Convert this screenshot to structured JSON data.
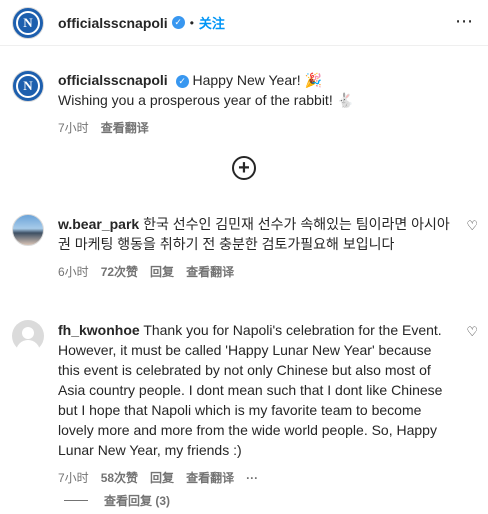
{
  "header": {
    "username": "officialsscnapoli",
    "separator": "•",
    "follow_label": "关注",
    "more_glyph": "⋯"
  },
  "caption": {
    "username": "officialsscnapoli",
    "line1": "Happy New Year! 🎉",
    "line2": "Wishing you a prosperous year of the rabbit! 🐇",
    "time": "7小时",
    "translate": "查看翻译"
  },
  "comments": [
    {
      "username": "w.bear_park",
      "text": "한국 선수인 김민재 선수가 속해있는 팀이라면 아시아권 마케팅 행동을 취하기 전 충분한 검토가필요해 보입니다",
      "time": "6小时",
      "likes": "72次赞",
      "reply": "回复",
      "translate": "查看翻译"
    },
    {
      "username": "fh_kwonhoe",
      "text": "Thank you for Napoli's celebration for the Event. However, it must be called 'Happy Lunar New Year' because this event is celebrated by not only Chinese but also most of Asia country people. I dont mean such that I dont like Chinese but I hope that Napoli which is my favorite team to become lovely more and more from the wide world people. So, Happy Lunar New Year, my friends :)",
      "time": "7小时",
      "likes": "58次赞",
      "reply": "回复",
      "translate": "查看翻译",
      "more": "···"
    }
  ],
  "view_replies": "查看回复 (3)",
  "icons": {
    "verified": "verified-badge-icon",
    "add": "add-circle-icon",
    "heart": "heart-outline-icon",
    "more": "more-horizontal-icon"
  },
  "colors": {
    "link": "#0095f6",
    "muted": "#737373",
    "text": "#262626",
    "verified": "#3897f0",
    "napoli_blue": "#1d5fae"
  }
}
